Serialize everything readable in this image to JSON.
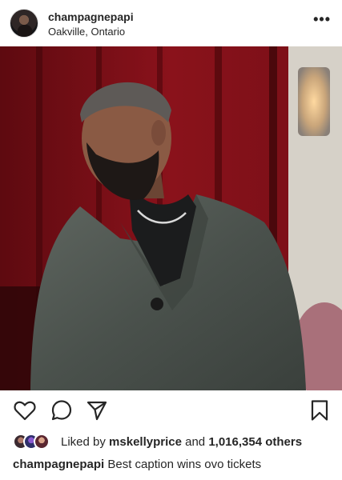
{
  "post": {
    "username": "champagnepapi",
    "location": "Oakville, Ontario",
    "more_icon": "more-horizontal-icon"
  },
  "actions": {
    "like_icon": "heart-icon",
    "comment_icon": "comment-icon",
    "share_icon": "send-icon",
    "save_icon": "bookmark-icon"
  },
  "likes": {
    "prefix": "Liked by",
    "liker": "mskellyprice",
    "conjunction": "and",
    "count": "1,016,354 others"
  },
  "caption": {
    "username": "champagnepapi",
    "text": "Best caption wins ovo tickets"
  },
  "colors": {
    "text": "#262626",
    "background": "#ffffff",
    "photo_background": "#6e0e14"
  }
}
